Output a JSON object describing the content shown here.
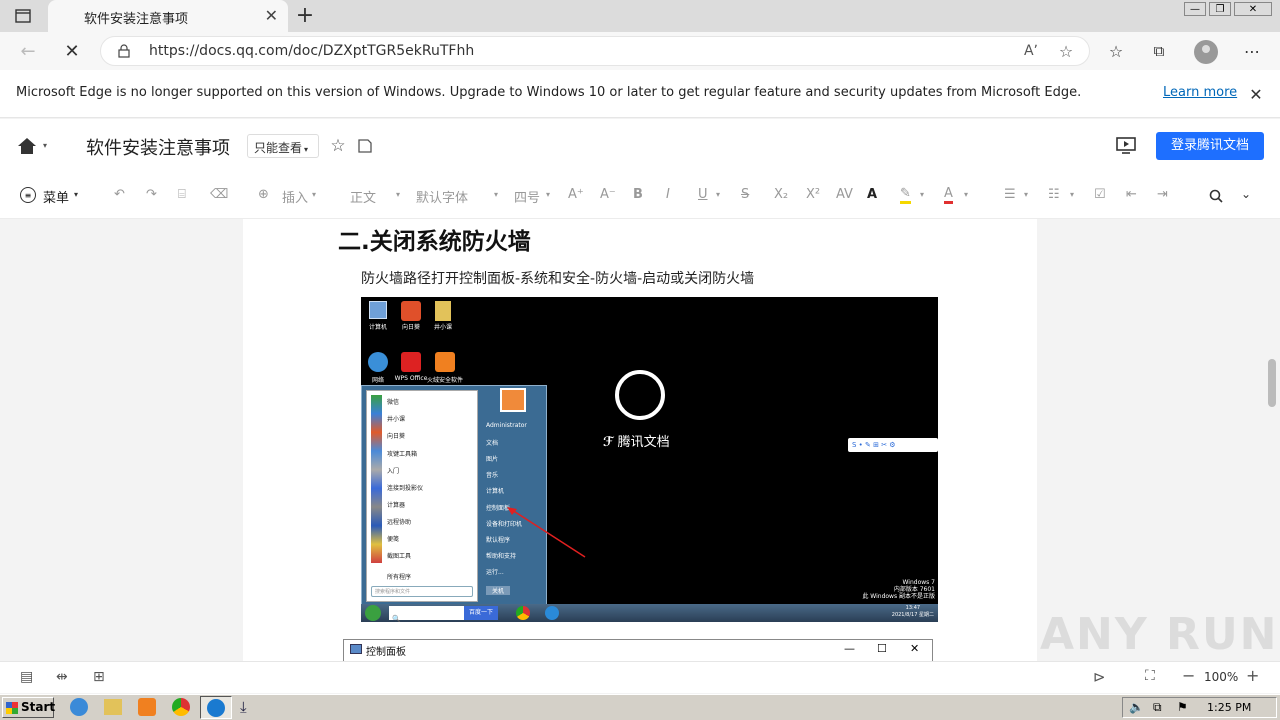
{
  "browser": {
    "tab_title": "软件安装注意事项",
    "url": "https://docs.qq.com/doc/DZXptTGR5ekRuTFhh"
  },
  "infobar": {
    "message": "Microsoft Edge is no longer supported on this version of Windows. Upgrade to Windows 10 or later to get regular feature and security updates from Microsoft Edge.",
    "learn_more": "Learn more"
  },
  "docheader": {
    "title": "软件安装注意事项",
    "mode": "只能查看",
    "login_button": "登录腾讯文档"
  },
  "toolbar": {
    "menu": "菜单",
    "insert": "插入",
    "style": "正文",
    "font": "默认字体",
    "size": "四号"
  },
  "document": {
    "heading": "二.关闭系统防火墙",
    "paragraph": "防火墙路径打开控制面板-系统和安全-防火墙-启动或关闭防火墙"
  },
  "screenshot1": {
    "desktop_icons": [
      "计算机",
      "向日葵",
      "井小课",
      "网络",
      "WPS Office",
      "火绒安全软件"
    ],
    "loading_brand": "腾讯文档",
    "start_menu_left": [
      "微信",
      "井小课",
      "向日葵",
      "攻键工具箱",
      "入门",
      "连接到投影仪",
      "计算器",
      "远程协助",
      "便笺",
      "截图工具"
    ],
    "all_programs": "所有程序",
    "search_placeholder": "搜索程序和文件",
    "start_menu_right": [
      "Administrator",
      "文档",
      "图片",
      "音乐",
      "计算机",
      "控制面板",
      "设备和打印机",
      "默认程序",
      "帮助和支持",
      "运行..."
    ],
    "shutdown": "关机",
    "search_button": "百度一下",
    "watermark_lines": [
      "Windows 7",
      "内部版本 7601",
      "此 Windows 副本不是正版"
    ],
    "clock": [
      "13:47",
      "2021/8/17 星期二"
    ]
  },
  "screenshot2": {
    "window_title": "控制面板"
  },
  "statusbar": {
    "zoom": "100%"
  },
  "watermark": "ANY RUN",
  "taskbar": {
    "start": "Start",
    "time": "1:25 PM"
  },
  "colors": {
    "accent": "#1e6fff",
    "link": "#0067b8"
  }
}
